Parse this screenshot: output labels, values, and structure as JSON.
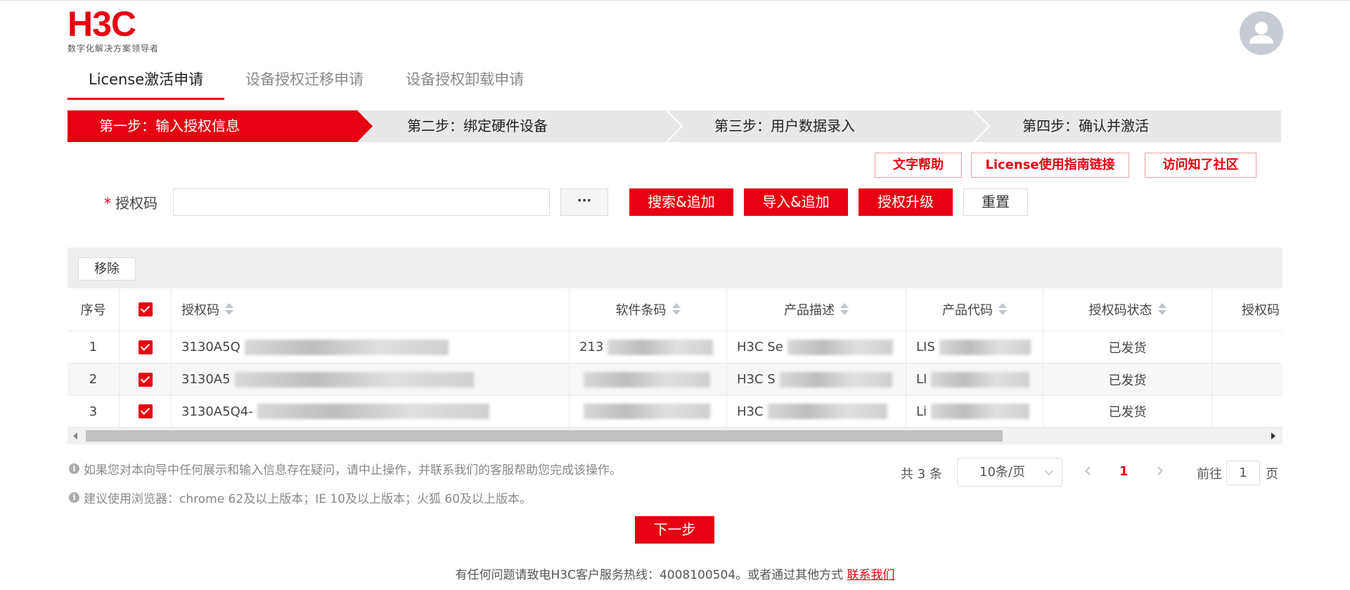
{
  "brand": {
    "logo_text": "H3C",
    "tagline": "数字化解决方案领导者",
    "accent_color": "#e60012"
  },
  "user": {
    "avatar_icon": "user-avatar-icon"
  },
  "tabs": [
    {
      "label": "License激活申请",
      "active": true
    },
    {
      "label": "设备授权迁移申请",
      "active": false
    },
    {
      "label": "设备授权卸载申请",
      "active": false
    }
  ],
  "steps": [
    {
      "label": "第一步：输入授权信息",
      "active": true
    },
    {
      "label": "第二步：绑定硬件设备",
      "active": false
    },
    {
      "label": "第三步：用户数据录入",
      "active": false
    },
    {
      "label": "第四步：确认并激活",
      "active": false
    }
  ],
  "help_links": {
    "text_help": "文字帮助",
    "license_guide": "License使用指南链接",
    "community": "访问知了社区"
  },
  "form": {
    "required_mark": "*",
    "code_label": "授权码",
    "code_value": "",
    "more_label": "···",
    "search_add": "搜索&追加",
    "import_add": "导入&追加",
    "upgrade": "授权升级",
    "reset": "重置"
  },
  "table": {
    "remove_label": "移除",
    "columns": {
      "index": "序号",
      "code": "授权码",
      "software": "软件条码",
      "description": "产品描述",
      "product_code": "产品代码",
      "status": "授权码状态",
      "extra": "授权码"
    },
    "rows": [
      {
        "index": "1",
        "code": "3130A5Q",
        "software": "213",
        "description": "H3C Se",
        "product_code": "LIS",
        "status": "已发货"
      },
      {
        "index": "2",
        "code": "3130A5",
        "software": "",
        "description": "H3C S",
        "product_code": "LI",
        "status": "已发货"
      },
      {
        "index": "3",
        "code": "3130A5Q4-",
        "software": "",
        "description": "H3C",
        "product_code": "Li",
        "status": "已发货"
      }
    ]
  },
  "notes": [
    "如果您对本向导中任何展示和输入信息存在疑问，请中止操作，并联系我们的客服帮助您完成该操作。",
    "建议使用浏览器：chrome 62及以上版本；IE 10及以上版本；火狐 60及以上版本。"
  ],
  "pagination": {
    "total": "共 3 条",
    "page_size": "10条/页",
    "current_page": "1",
    "goto_label": "前往",
    "goto_value": "1",
    "page_suffix": "页"
  },
  "next_label": "下一步",
  "footer": {
    "text": "有任何问题请致电H3C客户服务热线：4008100504。或者通过其他方式 ",
    "link": "联系我们"
  }
}
